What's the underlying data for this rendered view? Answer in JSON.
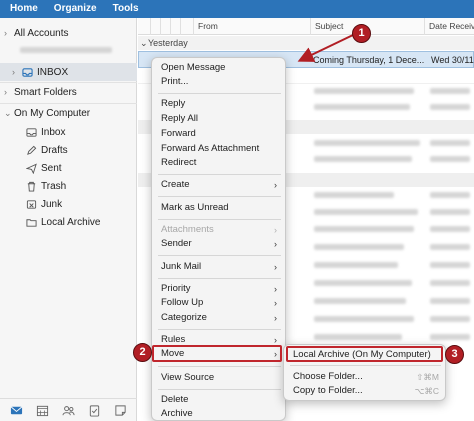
{
  "topbar": {
    "tabs": [
      "Home",
      "Organize",
      "Tools"
    ]
  },
  "sidebar": {
    "all_accounts": "All Accounts",
    "inbox": "INBOX",
    "smart_folders": "Smart Folders",
    "on_my_computer": "On My Computer",
    "folders": [
      "Inbox",
      "Drafts",
      "Sent",
      "Trash",
      "Junk",
      "Local Archive"
    ]
  },
  "list": {
    "columns": {
      "from": "From",
      "subject": "Subject",
      "date": "Date Receiv"
    },
    "group_yesterday": "Yesterday",
    "selected_row": {
      "subject": "Coming Thursday, 1 Dece...",
      "date": "Wed 30/11"
    }
  },
  "context_menu": {
    "items": [
      "Open Message",
      "Print...",
      "Reply",
      "Reply All",
      "Forward",
      "Forward As Attachment",
      "Redirect",
      "Create",
      "Mark as Unread",
      "Attachments",
      "Sender",
      "Junk Mail",
      "Priority",
      "Follow Up",
      "Categorize",
      "Rules",
      "Move",
      "View Source",
      "Delete",
      "Archive"
    ]
  },
  "submenu": {
    "items": [
      "Local Archive (On My Computer)",
      "Choose Folder...",
      "Copy to Folder..."
    ],
    "shortcuts": [
      "",
      "⇧⌘M",
      "⌥⌘C"
    ]
  },
  "annotations": {
    "badges": [
      "1",
      "2",
      "3"
    ],
    "color": "#b11e24"
  },
  "colors": {
    "topbar": "#2c74b9",
    "selection": "#d7e6f5",
    "highlight": "#c0262d"
  }
}
